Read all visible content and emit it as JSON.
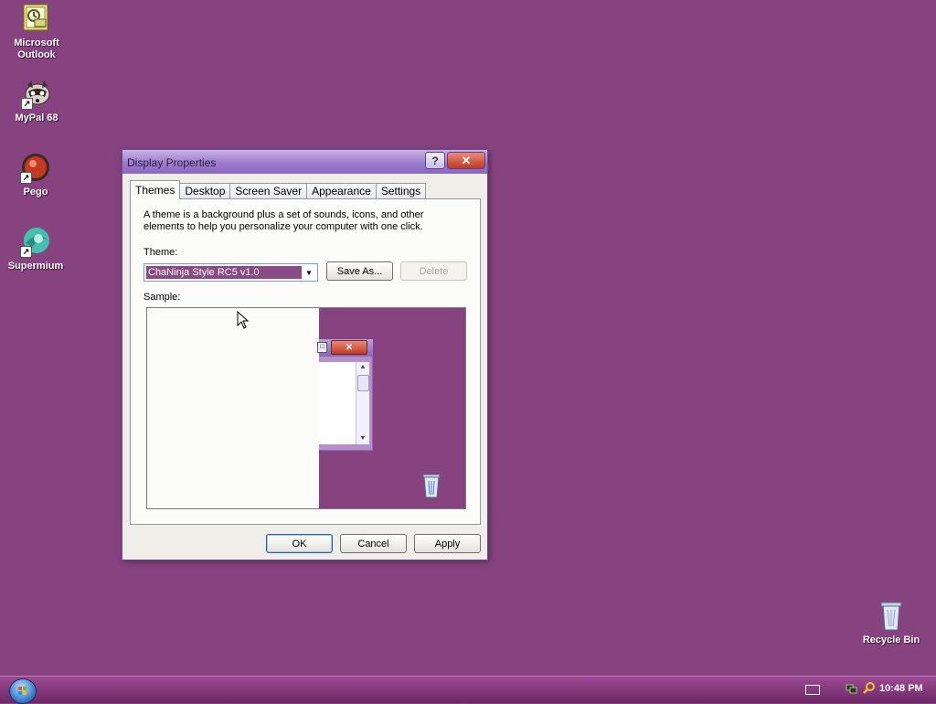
{
  "desktop": {
    "icons": [
      {
        "label": "Microsoft Outlook",
        "icon": "outlook-icon"
      },
      {
        "label": "MyPal 68",
        "icon": "mypal-raccoon-icon"
      },
      {
        "label": "Pego",
        "icon": "pego-icon"
      },
      {
        "label": "Supermium",
        "icon": "supermium-icon"
      },
      {
        "label": "Recycle Bin",
        "icon": "recycle-bin-icon"
      }
    ]
  },
  "dialog": {
    "title": "Display Properties",
    "help_glyph": "?",
    "close_glyph": "✕",
    "tabs": [
      {
        "label": "Themes",
        "active": true
      },
      {
        "label": "Desktop"
      },
      {
        "label": "Screen Saver"
      },
      {
        "label": "Appearance"
      },
      {
        "label": "Settings"
      }
    ],
    "description": "A theme is a background plus a set of sounds, icons, and other elements to help you personalize your computer with one click.",
    "theme_label": "Theme:",
    "theme_value": "ChaNinja Style RC5 v1.0",
    "save_as": "Save As...",
    "delete": "Delete",
    "sample_label": "Sample:",
    "ok": "OK",
    "cancel": "Cancel",
    "apply": "Apply"
  },
  "taskbar": {
    "clock": "10:48 PM"
  },
  "colors": {
    "desktop_bg": "#86437f",
    "dialog_title": "#9d7ccd",
    "close_red": "#c23a22",
    "theme_highlight": "#8a4a86"
  }
}
